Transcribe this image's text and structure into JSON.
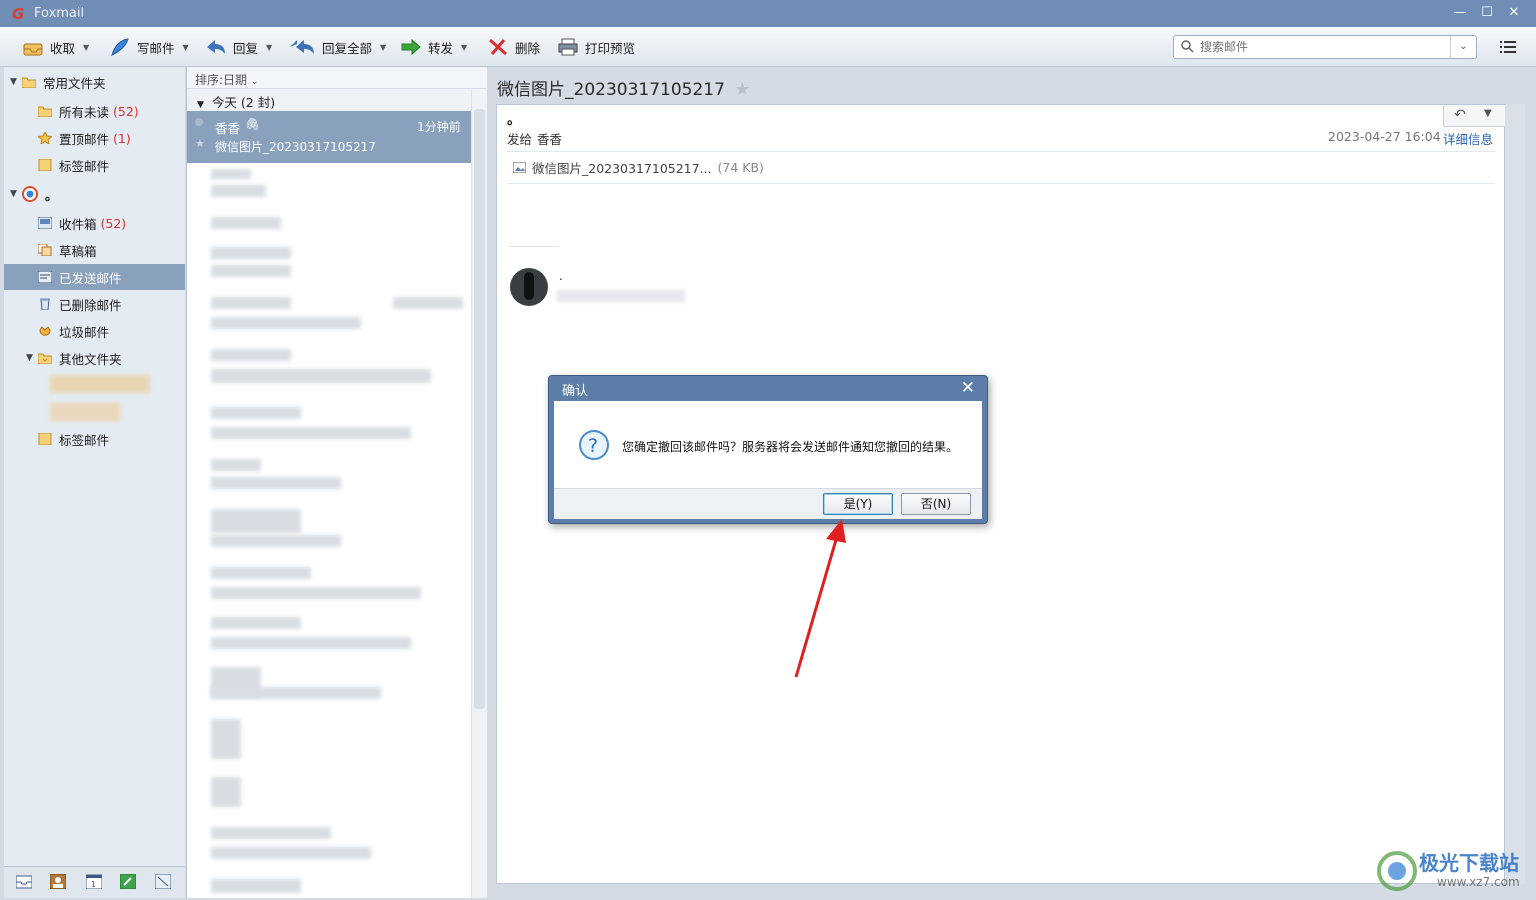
{
  "app": {
    "title": "Foxmail"
  },
  "toolbar": {
    "receive": "收取",
    "compose": "写邮件",
    "reply": "回复",
    "reply_all": "回复全部",
    "forward": "转发",
    "delete": "删除",
    "print_preview": "打印预览"
  },
  "search": {
    "placeholder": "搜索邮件"
  },
  "sidebar": {
    "common_folders": "常用文件夹",
    "all_unread": "所有未读",
    "all_unread_count": "(52)",
    "pinned": "置顶邮件",
    "pinned_count": "(1)",
    "tagged": "标签邮件",
    "account": "。",
    "inbox": "收件箱",
    "inbox_count": "(52)",
    "drafts": "草稿箱",
    "sent": "已发送邮件",
    "deleted": "已删除邮件",
    "junk": "垃圾邮件",
    "other_folders": "其他文件夹",
    "tagged2": "标签邮件"
  },
  "maillist": {
    "sort_label": "排序:日期",
    "group": "今天 (2 封)",
    "selected": {
      "sender": "香香",
      "time": "1分钟前",
      "subject": "微信图片_20230317105217"
    }
  },
  "reader": {
    "subject": "微信图片_20230317105217",
    "from_line": "。",
    "to_label": "发给",
    "to_name": "香香",
    "date": "2023-04-27 16:04",
    "details": "详细信息",
    "attachment_name": "微信图片_20230317105217...",
    "attachment_size": "(74 KB)",
    "sig_name": "."
  },
  "dialog": {
    "title": "确认",
    "message": "您确定撤回该邮件吗？服务器将会发送邮件通知您撤回的结果。",
    "yes": "是(Y)",
    "no": "否(N)"
  },
  "watermark": {
    "brand": "极光下载站",
    "url": "www.xz7.com"
  },
  "colors": {
    "selection": "#8aa1bd",
    "titlebar": "#6f8db5",
    "count_red": "#e03030",
    "arrow_red": "#e02020"
  }
}
